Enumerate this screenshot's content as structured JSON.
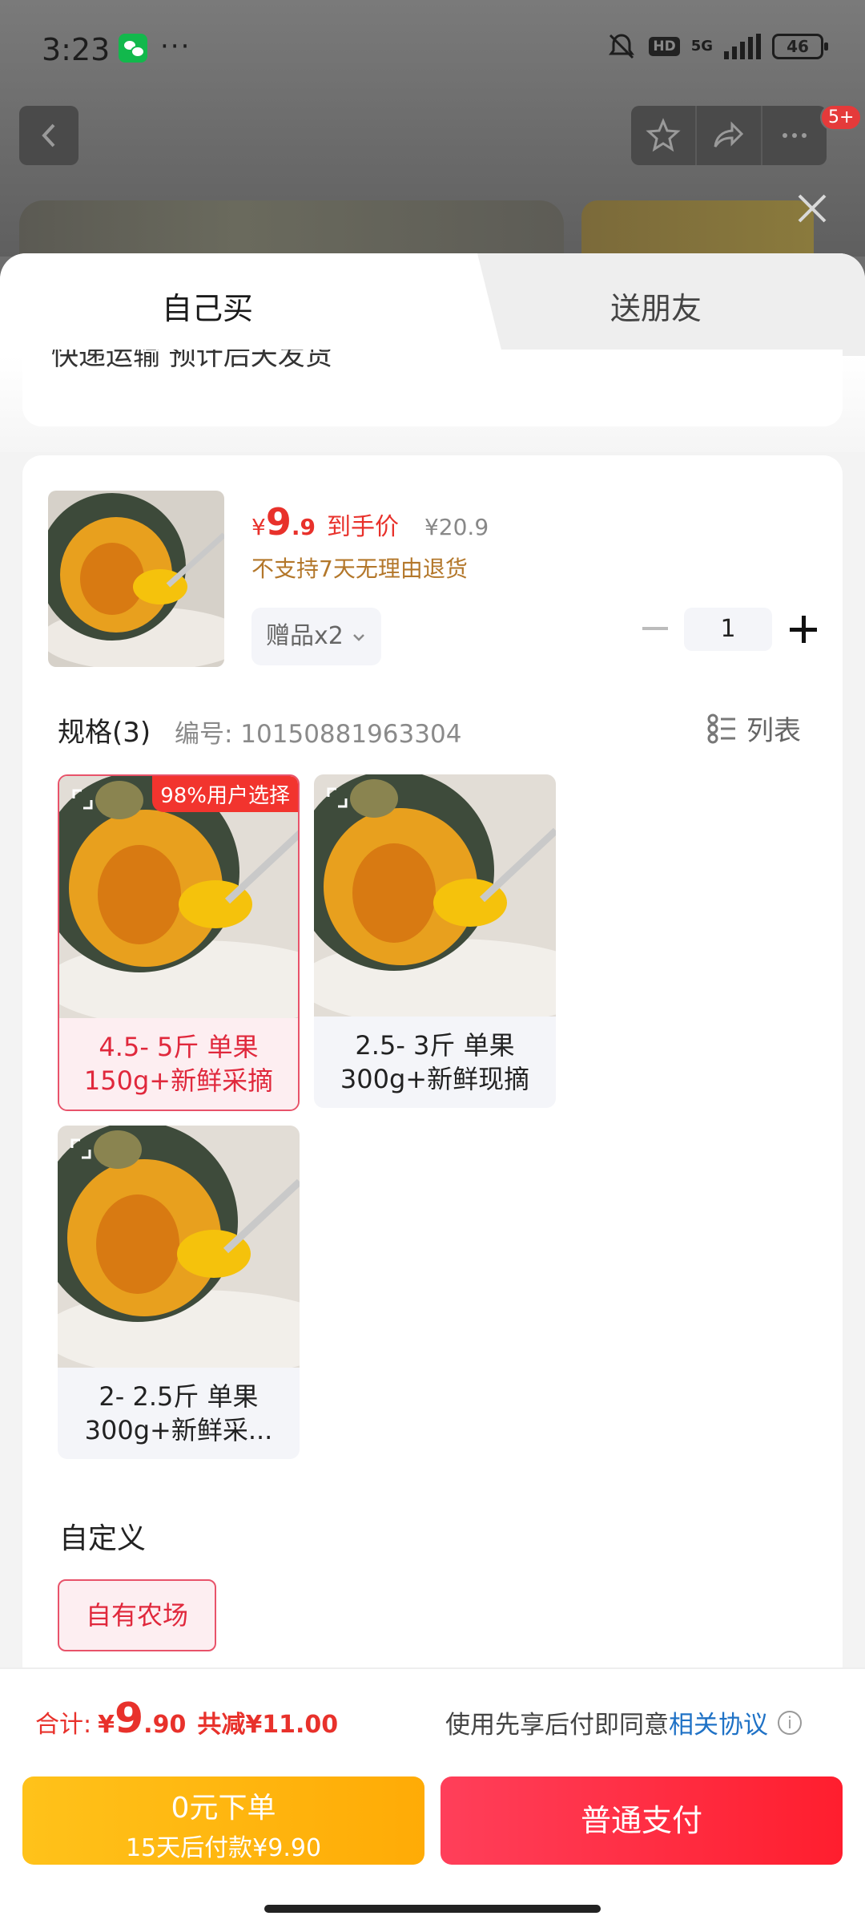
{
  "status_bar": {
    "time": "3:23",
    "dots": "···",
    "hd": "HD",
    "network": "5G",
    "battery": "46"
  },
  "header": {
    "cart_badge": "5+",
    "icons": [
      "back-icon",
      "star-icon",
      "share-icon",
      "more-icon",
      "close-icon"
    ]
  },
  "tabs": [
    {
      "label": "自己买",
      "selected": true
    },
    {
      "label": "送朋友",
      "selected": false
    }
  ],
  "shipping_note_partial": "快递运输 预计后天发货",
  "product": {
    "price_symbol": "¥",
    "price_int": "9",
    "price_dec": ".9",
    "price_label": "到手价",
    "original_price": "¥20.9",
    "return_notice": "不支持7天无理由退货",
    "gift_label": "赠品x2",
    "quantity": "1"
  },
  "spec": {
    "title": "规格(3)",
    "code": "编号: 10150881963304",
    "list_label": "列表",
    "items": [
      {
        "line1": "4.5- 5斤 单果",
        "line2": "150g+新鲜采摘",
        "badge": "98%用户选择",
        "selected": true
      },
      {
        "line1": "2.5- 3斤 单果",
        "line2": "300g+新鲜现摘",
        "selected": false
      },
      {
        "line1": "2- 2.5斤 单果",
        "line2": "300g+新鲜采...",
        "selected": false
      }
    ]
  },
  "custom": {
    "title": "自定义",
    "tag": "自有农场"
  },
  "footer": {
    "total_label": "合计:",
    "total_symbol": "¥",
    "total_int": "9",
    "total_dec": ".90",
    "discount": "共减¥11.00",
    "agree_text": "使用先享后付即同意",
    "agree_link": "相关协议",
    "credit_line1": "0元下单",
    "credit_line2": "15天后付款¥9.90",
    "pay_label": "普通支付"
  },
  "colors": {
    "accent_red": "#e8312b",
    "gold": "#ffb20f",
    "link_blue": "#1f72c6"
  }
}
